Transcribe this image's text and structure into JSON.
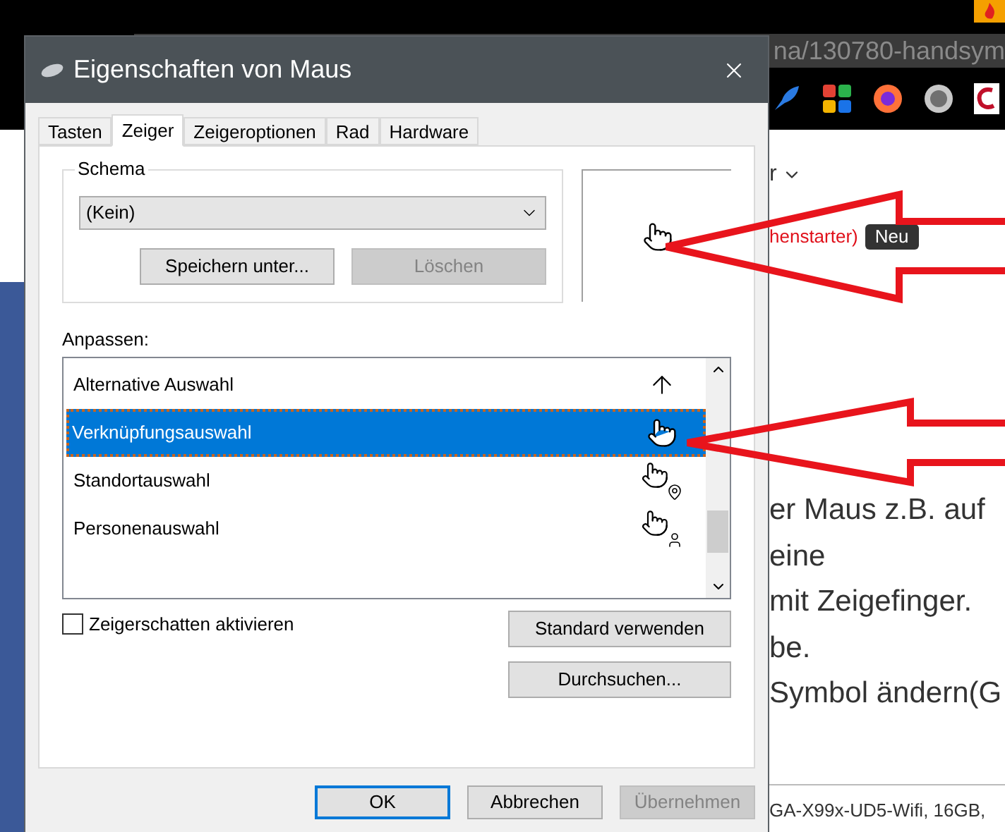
{
  "browser": {
    "address_fragment": "na/130780-handsym",
    "menu_fragment": "r",
    "link_fragment": "henstarter)",
    "badge": "Neu",
    "text_lines": [
      "er Maus z.B. auf",
      "eine",
      "mit Zeigefinger.",
      "be.",
      "Symbol ändern(G"
    ],
    "footer_fragment": "GA-X99x-UD5-Wifi, 16GB,"
  },
  "dialog": {
    "title": "Eigenschaften von Maus",
    "tabs": [
      {
        "label": "Tasten",
        "selected": false
      },
      {
        "label": "Zeiger",
        "selected": true
      },
      {
        "label": "Zeigeroptionen",
        "selected": false
      },
      {
        "label": "Rad",
        "selected": false
      },
      {
        "label": "Hardware",
        "selected": false
      }
    ],
    "scheme": {
      "label": "Schema",
      "value": "(Kein)",
      "buttons": [
        {
          "label": "Speichern unter...",
          "disabled": false
        },
        {
          "label": "Löschen",
          "disabled": true
        }
      ]
    },
    "customize": {
      "label": "Anpassen:",
      "items": [
        {
          "name": "Alternative Auswahl",
          "kind": "arrow",
          "selected": false
        },
        {
          "name": "Verknüpfungsauswahl",
          "kind": "hand",
          "selected": true
        },
        {
          "name": "Standortauswahl",
          "kind": "hand-pin",
          "selected": false
        },
        {
          "name": "Personenauswahl",
          "kind": "hand-person",
          "selected": false
        }
      ]
    },
    "shadow": {
      "label": "Zeigerschatten aktivieren",
      "checked": false
    },
    "side_buttons": [
      "Standard verwenden",
      "Durchsuchen..."
    ],
    "footer_buttons": [
      {
        "label": "OK",
        "default": true,
        "disabled": false
      },
      {
        "label": "Abbrechen",
        "default": false,
        "disabled": false
      },
      {
        "label": "Übernehmen",
        "default": false,
        "disabled": true
      }
    ]
  }
}
